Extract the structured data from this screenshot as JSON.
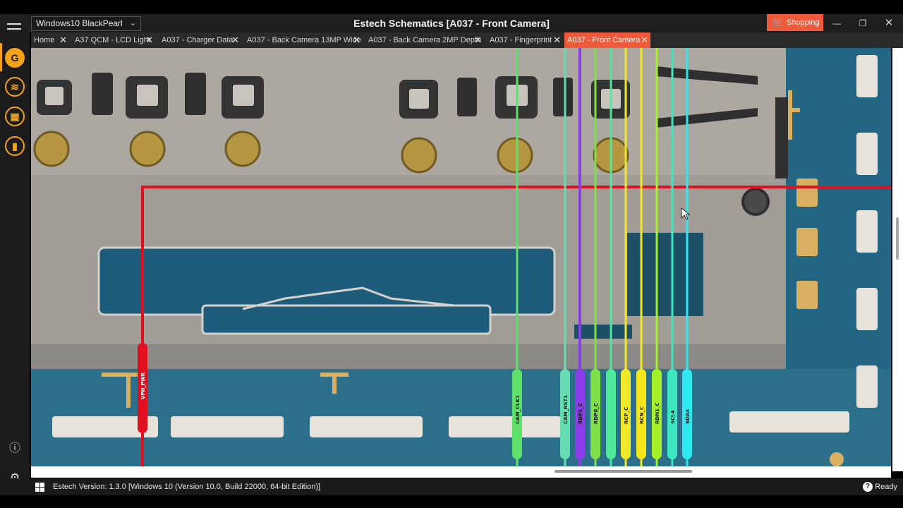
{
  "window": {
    "title": "Estech Schematics [A037 - Front Camera]",
    "theme_select_value": "Windows10 BlackPearl",
    "shopping_label": "Shopping"
  },
  "tabs": [
    {
      "label": "Home",
      "active": false
    },
    {
      "label": "A37 QCM - LCD Light",
      "active": false
    },
    {
      "label": "A037 - Charger Data",
      "active": false
    },
    {
      "label": "A037 - Back Camera 13MP Wide",
      "active": false
    },
    {
      "label": "A037 - Back Camera 2MP Depth",
      "active": false
    },
    {
      "label": "A037 - Fingerprint",
      "active": false
    },
    {
      "label": "A037 - Front Camera",
      "active": true
    }
  ],
  "sidebar": {
    "items": [
      {
        "icon": "estech-logo-icon",
        "active": true
      },
      {
        "icon": "circuit-icon",
        "active": false
      },
      {
        "icon": "chip-icon",
        "active": false
      },
      {
        "icon": "battery-icon",
        "active": false
      }
    ],
    "bottom": [
      {
        "icon": "info-icon"
      },
      {
        "icon": "gear-icon"
      }
    ]
  },
  "schematic": {
    "nets": [
      {
        "name": "VPH_PWR",
        "color": "#e01020"
      },
      {
        "name": "CAM_CLK1",
        "color": "#5ee06a"
      },
      {
        "name": "CAM_RST1",
        "color": "#66ddb0"
      },
      {
        "name": "RDP1_C",
        "color": "#8a3de8"
      },
      {
        "name": "RDP0_C",
        "color": "#7fe04a"
      },
      {
        "name": "",
        "color": "#4ee89a"
      },
      {
        "name": "RCP_C",
        "color": "#f0e82a"
      },
      {
        "name": "RCN_C",
        "color": "#f5e61e"
      },
      {
        "name": "RDN1_C",
        "color": "#a6f02a"
      },
      {
        "name": "SCL4",
        "color": "#3de8c0"
      },
      {
        "name": "SDA4",
        "color": "#2ee8f0"
      }
    ]
  },
  "status": {
    "version_text": "Estech Version: 1.3.0 [Windows 10 (Version 10.0, Build 22000, 64-bit Edition)]",
    "state": "Ready"
  },
  "colors": {
    "accent": "#ef5a3a",
    "sidebar_accent": "#f4a21a"
  }
}
